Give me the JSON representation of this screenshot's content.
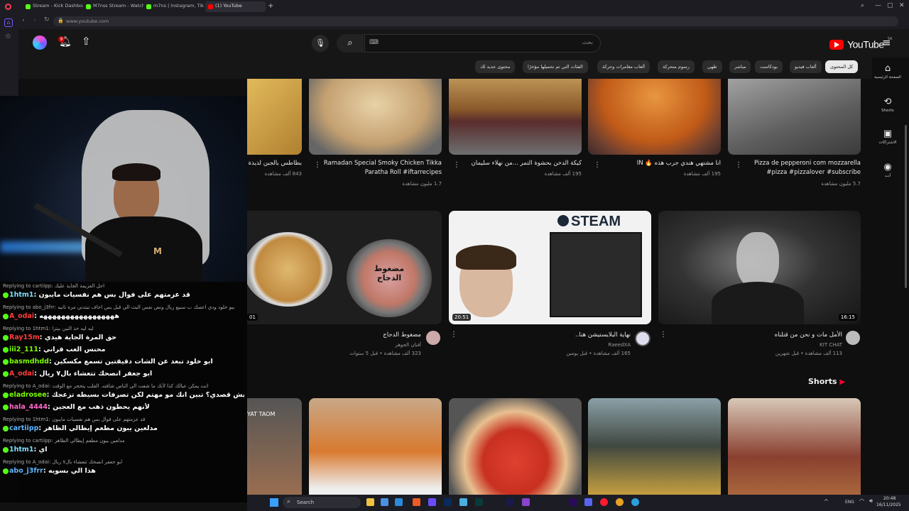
{
  "browser": {
    "tabs": [
      {
        "label": "Stream - Kick Dashboard",
        "color": "#53fc18"
      },
      {
        "label": "M7nss Stream - Watch Li",
        "color": "#53fc18"
      },
      {
        "label": "m7ns | Instagram, TikTok",
        "color": "#53fc18"
      },
      {
        "label": "(1) YouTube",
        "color": "#ff0000"
      }
    ],
    "url": "www.youtube.com"
  },
  "youtube": {
    "logo_text": "YouTube",
    "region": "SA",
    "search_placeholder": "بحث",
    "notification_count": "9",
    "chips": [
      "كل المحتوى",
      "ألعاب فيديو",
      "بودكاست",
      "مباشر",
      "طهي",
      "رسوم متحركة",
      "ألعاب مغامرات وحركة",
      "الفئات التي تم تحميلها مؤخرًا",
      "محتوى جديد لك"
    ],
    "nav": [
      {
        "label": "الصفحة الرئيسية",
        "icon": "home-icon"
      },
      {
        "label": "Shorts",
        "icon": "shorts-icon"
      },
      {
        "label": "الاشتراكات",
        "icon": "subscriptions-icon"
      },
      {
        "label": "أنت",
        "icon": "you-icon"
      }
    ],
    "row1": [
      {
        "title": "Pizza de pepperoni com mozzarella #pizza #pizzalover #subscribe",
        "views": "5.7 مليون مشاهدة"
      },
      {
        "title": "انا مشتهي هندي جرب هذه 🔥 IN",
        "views": "195 ألف مشاهدة"
      },
      {
        "title": "كيكة الدخن بحشوة التمر ...من نهلاء سليمان",
        "views": "195 ألف مشاهدة"
      },
      {
        "title": "Ramadan Special Smoky Chicken Tikka Paratha Roll #iftarrecipes",
        "views": "1.7 مليون مشاهدة"
      },
      {
        "title": "بطاطس بالجبن لذيذة و",
        "views": "843 ألف مشاهدة"
      }
    ],
    "row2": [
      {
        "title": "الأمل مات و نحن من قتلناه",
        "channel": "KIT CHAT",
        "meta": "113 ألف مشاهدة • قبل شهرين",
        "duration": "16:15"
      },
      {
        "title": "نهاية البلايستيشن هنا..",
        "channel": "RaeedXA",
        "meta": "165 ألف مشاهدة • قبل يومين",
        "duration": "20:51",
        "thumb_text": "STEAM"
      },
      {
        "title": "مضغوط الدجاج",
        "channel": "أفنان الجوهر",
        "meta": "323 ألف مشاهدة • قبل 5 سنوات",
        "duration": "01",
        "thumb_text": "مضغوط الدجاج"
      }
    ],
    "shorts_label": "Shorts",
    "shorts_partial_text": "YAT TAOM"
  },
  "chat": {
    "lines": [
      {
        "type": "reply",
        "text": "Replying to cartiipp: اجل العزيمة الجاية عليك"
      },
      {
        "type": "msg",
        "user": "1htm1",
        "ucolor": "#7be0ff",
        "text": "قد عزمتهم على فوال بس هم نفسيات مايبون"
      },
      {
        "type": "reply",
        "text": "Replying to abo_j3frr: يبو خلود ودي اعصك ب سبيع ريال ونص نفس البث الي قبل بس اخاف تبتدني مرة ثانيه"
      },
      {
        "type": "msg",
        "user": "A_odai",
        "ucolor": "#ff3b3b",
        "text": "هههههههههههههههههه"
      },
      {
        "type": "reply",
        "text": "Replying to 1htm1: ليه ليه خذ التين بيتزا"
      },
      {
        "type": "msg",
        "user": "Ray15m",
        "ucolor": "#ff3b3b",
        "text": "حق المرة الجاية هيدي"
      },
      {
        "type": "msg",
        "user": "iii2_111",
        "ucolor": "#7CFC00",
        "text": "محنس العب قراني"
      },
      {
        "type": "msg",
        "user": "basmdhdd",
        "ucolor": "#7CFC00",
        "text": "ابو خلود تبعد عن الشات دقيقتين تسمع مكسكين"
      },
      {
        "type": "msg",
        "user": "A_odai",
        "ucolor": "#ff3b3b",
        "text": "ابو جعفر انصحك تتعشاء بال٧ ريال"
      },
      {
        "type": "reply",
        "text": "Replying to A_odai: انت يمكن عيالك كذا لأنك ما شفت الي الناس شافته. القلب يتحجر مع الوقت"
      },
      {
        "type": "msg",
        "user": "eladrosee",
        "ucolor": "#7CFC00",
        "text": "انت فاهم ايش قصدي؟ تبين انك مو مهتم لكن تصرفات بسيطه تزعجك"
      },
      {
        "type": "msg",
        "user": "hala_4444",
        "ucolor": "#ff66cc",
        "text": "لأنهم يحطون ذهب مع العجين"
      },
      {
        "type": "reply",
        "text": "Replying to 1htm1: قد عزمتهم على فوال بس هم نفسيات مايبون"
      },
      {
        "type": "msg",
        "user": "cartiipp",
        "ucolor": "#5fb4ff",
        "text": "مدلعين يبون مطعم إيطالي الظاهر"
      },
      {
        "type": "reply",
        "text": "Replying to cartiipp: مدلعين يبون مطعم إيطالي الظاهر"
      },
      {
        "type": "msg",
        "user": "1htm1",
        "ucolor": "#7be0ff",
        "text": "اي"
      },
      {
        "type": "reply",
        "text": "Replying to A_odai: ابو جعفر انصحك تتعشاء بال٧ ريال"
      },
      {
        "type": "msg",
        "user": "abo_j3frr",
        "ucolor": "#5fb4ff",
        "text": "هذا الي بسويه"
      }
    ]
  },
  "taskbar": {
    "search_label": "Search",
    "lang": "ENG",
    "time": "20:48",
    "date": "16/11/2025"
  }
}
